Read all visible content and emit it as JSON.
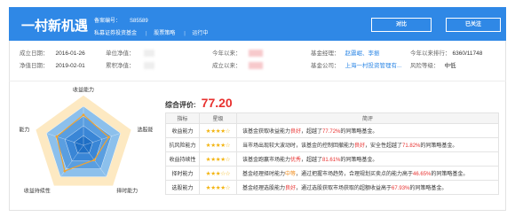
{
  "header": {
    "title": "一村新机遇",
    "code_label": "备案编号：",
    "code_value": "S85589",
    "tags": [
      "私募证券投资基金",
      "股票策略",
      "运行中"
    ],
    "compare_label": "对比",
    "follow_label": "已关注"
  },
  "info": {
    "established_label": "成立日期：",
    "established_value": "2016-01-26",
    "nav_date_label": "净值日期：",
    "nav_date_value": "2019-02-01",
    "unit_nav_label": "单位净值：",
    "cum_nav_label": "累积净值：",
    "since_inception_label": "今年以来：",
    "since_established_label": "成立以来：",
    "manager_label": "基金经理：",
    "manager_value": "赵震岷、李振",
    "company_label": "基金公司：",
    "company_value": "上海一村投资管理有...",
    "ytd_rank_label": "今年以来排行：",
    "ytd_rank_value": "6360/11748",
    "risk_label": "风险等级：",
    "risk_value": "中低"
  },
  "evaluation": {
    "score_label": "综合评价:",
    "score_value": "77.20",
    "columns": [
      "指标",
      "星级",
      "简评"
    ],
    "rows": [
      {
        "name": "收益能力",
        "stars": "★★★★☆",
        "pre": "该基金获取收益能力",
        "level": "良好",
        "mid": "，超越了",
        "pct": "77.72%",
        "post": "的同策略基金。"
      },
      {
        "name": "抗风险能力",
        "stars": "★★★★☆",
        "pre": "当市场出现较大波动时，该基金的控制回撤能力",
        "level": "良好",
        "mid": "，安全性超越了",
        "pct": "71.82%",
        "post": "的同策略基金。"
      },
      {
        "name": "收益持续性",
        "stars": "★★★★☆",
        "pre": "该基金跑赢市场能力",
        "level": "优秀",
        "mid": "，超越了",
        "pct": "81.61%",
        "post": "的同策略基金。"
      },
      {
        "name": "择时能力",
        "stars": "★★★☆☆",
        "pre": "基金经理择时能力",
        "level": "中等",
        "mid": "，通过把握市场趋势，合理规划买卖点的能力高于",
        "pct": "46.65%",
        "post": "的同策略基金。"
      },
      {
        "name": "选股能力",
        "stars": "★★★★☆",
        "pre": "基金经理选股能力",
        "level": "良好",
        "mid": "，通过选股获取市场获取的超额收益高于",
        "pct": "67.93%",
        "post": "的同策略基金。"
      }
    ]
  },
  "radar": {
    "axes": [
      "收益能力",
      "选股能力",
      "择时能力",
      "收益持续性",
      "抗风险能力"
    ],
    "values": [
      77.72,
      67.93,
      46.65,
      81.61,
      71.82
    ],
    "max": 100,
    "colors": {
      "bg": "#fde9c2",
      "rings": [
        "#1f6fc5",
        "#3a86d6",
        "#5a9ee0",
        "#8cc0ec"
      ],
      "line": "#f0a330"
    }
  },
  "colors": {
    "brand": "#2f88e6",
    "accent": "#e8312f"
  }
}
